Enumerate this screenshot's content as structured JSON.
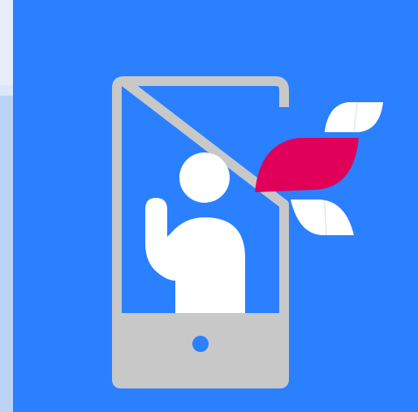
{
  "illustration": {
    "subject": "video-call",
    "icons": {
      "phone": "phone-icon",
      "person": "person-waving-icon",
      "home_button": "home-button-icon",
      "leaves": "leaf-swoosh-icon"
    },
    "colors": {
      "background": "#2a80ff",
      "phone_frame": "#c8c8c8",
      "person": "#ffffff",
      "accent_leaf": "#e0005a",
      "white_leaf": "#ffffff",
      "page_backdrop": "#bcd3f5"
    }
  }
}
